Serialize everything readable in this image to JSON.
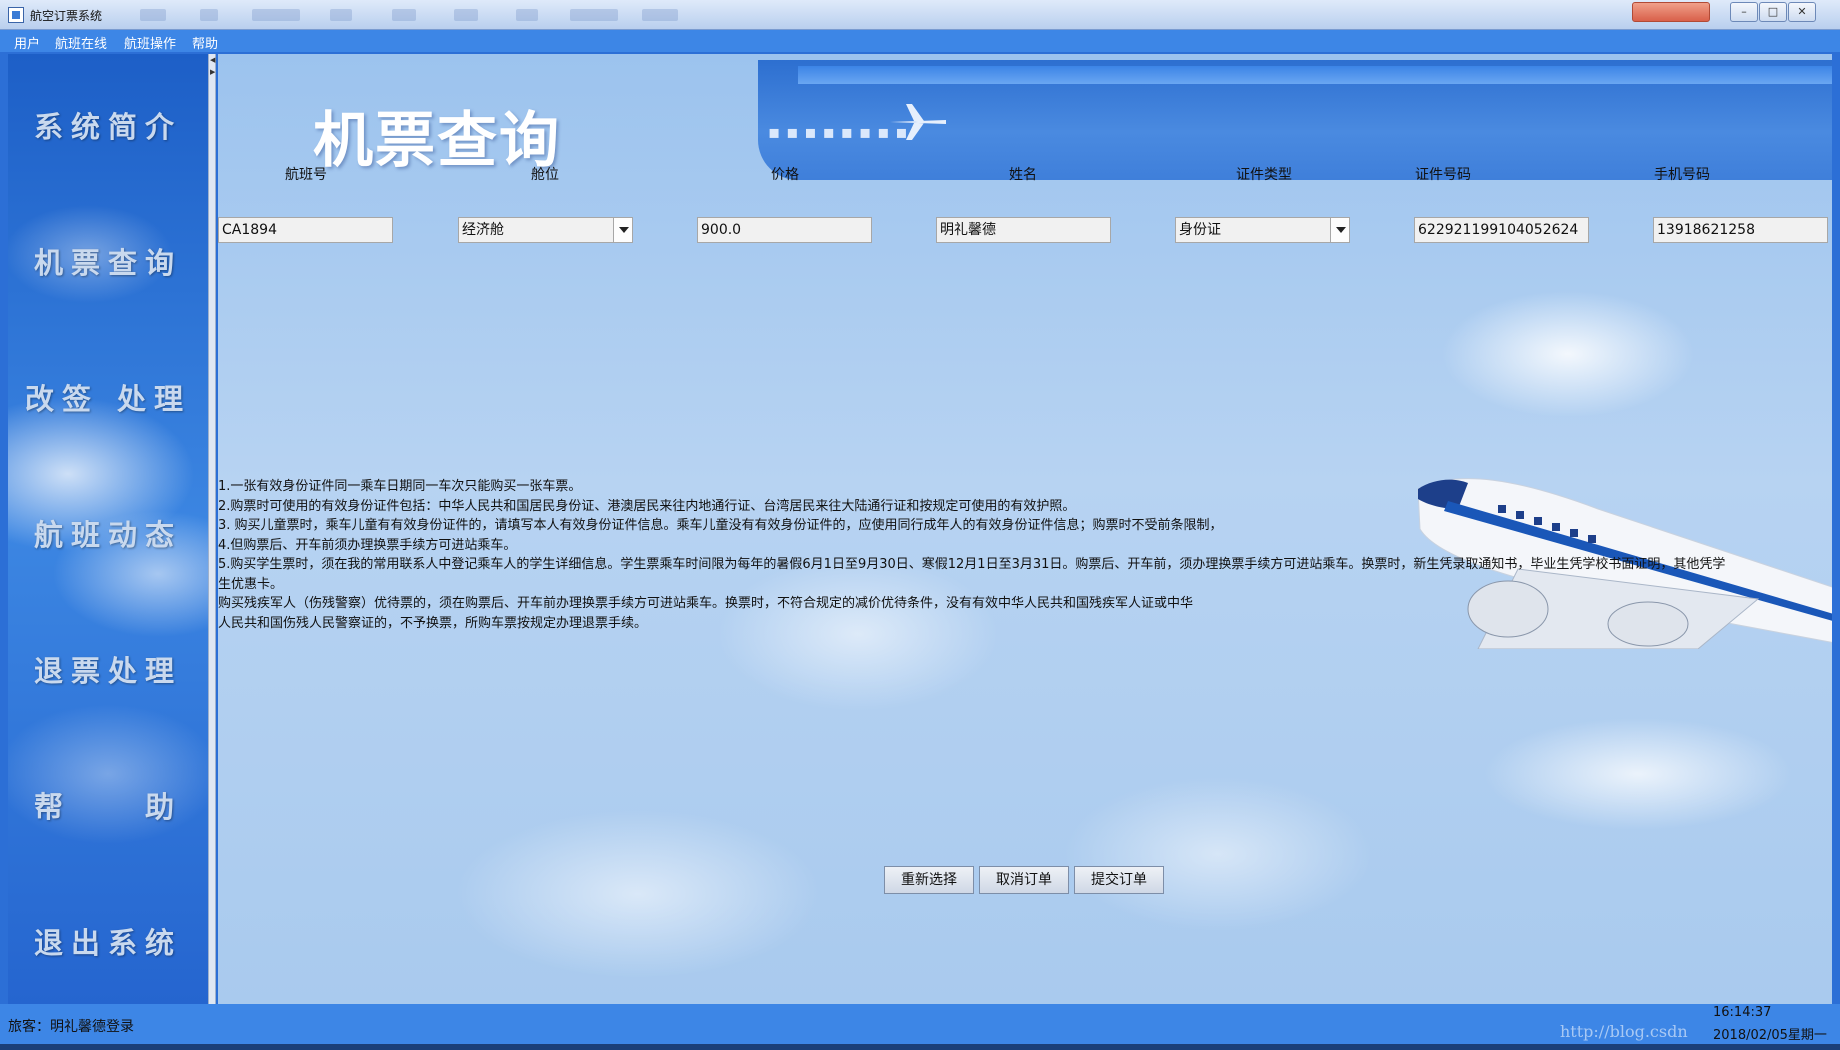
{
  "window": {
    "title": "航空订票系统"
  },
  "menu": [
    "用户",
    "航班在线",
    "航班操作",
    "帮助"
  ],
  "sidebar": [
    {
      "label": "系统简介"
    },
    {
      "label": "机票查询"
    },
    {
      "label": "改签 处理"
    },
    {
      "label": "航班动态"
    },
    {
      "label": "退票处理"
    },
    {
      "label": "帮　　助"
    },
    {
      "label": "退出系统"
    }
  ],
  "page": {
    "title": "机票查询"
  },
  "fields": {
    "labels": [
      "航班号",
      "舱位",
      "价格",
      "姓名",
      "证件类型",
      "证件号码",
      "手机号码"
    ],
    "flight_no": "CA1894",
    "cabin": "经济舱",
    "price": "900.0",
    "name": "明礼馨德",
    "id_type": "身份证",
    "id_number": "622921199104052624",
    "phone": "13918621258"
  },
  "notice": [
    "1.一张有效身份证件同一乘车日期同一车次只能购买一张车票。",
    "2.购票时可使用的有效身份证件包括：中华人民共和国居民身份证、港澳居民来往内地通行证、台湾居民来往大陆通行证和按规定可使用的有效护照。",
    "3. 购买儿童票时，乘车儿童有有效身份证件的，请填写本人有效身份证件信息。乘车儿童没有有效身份证件的，应使用同行成年人的有效身份证件信息；购票时不受前条限制，",
    "4.但购票后、开车前须办理换票手续方可进站乘车。",
    "5.购买学生票时，须在我的常用联系人中登记乘车人的学生详细信息。学生票乘车时间限为每年的暑假6月1日至9月30日、寒假12月1日至3月31日。购票后、开车前，须办理换票手续方可进站乘车。换票时，新生凭录取通知书，毕业生凭学校书面证明，其他凭学",
    "生优惠卡。",
    "购买残疾军人（伤残警察）优待票的，须在购票后、开车前办理换票手续方可进站乘车。换票时，不符合规定的减价优待条件，没有有效中华人民共和国残疾军人证或中华",
    "人民共和国伤残人民警察证的，不予换票，所购车票按规定办理退票手续。"
  ],
  "buttons": {
    "reset": "重新选择",
    "cancel": "取消订单",
    "submit": "提交订单"
  },
  "status": {
    "login": "旅客：明礼馨德登录",
    "time": "16:14:37",
    "date": "2018/02/05星期一"
  },
  "watermark": "http://blog.csdn"
}
